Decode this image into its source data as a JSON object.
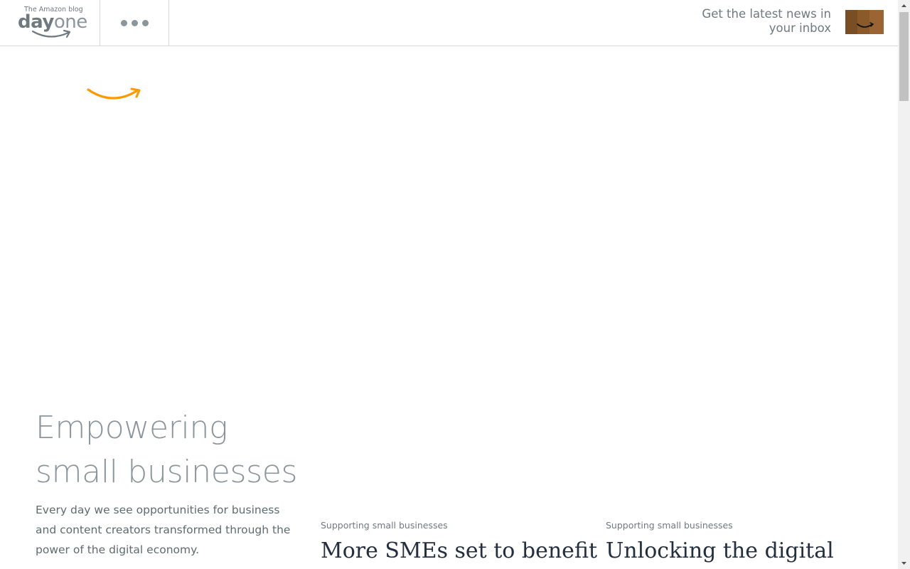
{
  "header": {
    "logo": {
      "tagline": "The Amazon blog",
      "wordmark_day": "day",
      "wordmark_one": "one",
      "smile_color": "#6f7a80"
    },
    "menu_icon": "more-dots-icon",
    "newsletter_text": "Get the latest news in your inbox",
    "newsletter_icon": "amazon-box-icon"
  },
  "hero": {
    "icon": "amazon-smile-icon",
    "accent_color": "#ff9900"
  },
  "section": {
    "title": "Empowering small businesses",
    "description": "Every day we see opportunities for business and content creators transformed through the power of the digital economy."
  },
  "cards": [
    {
      "category": "Supporting small businesses",
      "title": "More SMEs set to benefit"
    },
    {
      "category": "Supporting small businesses",
      "title": "Unlocking the digital"
    }
  ]
}
